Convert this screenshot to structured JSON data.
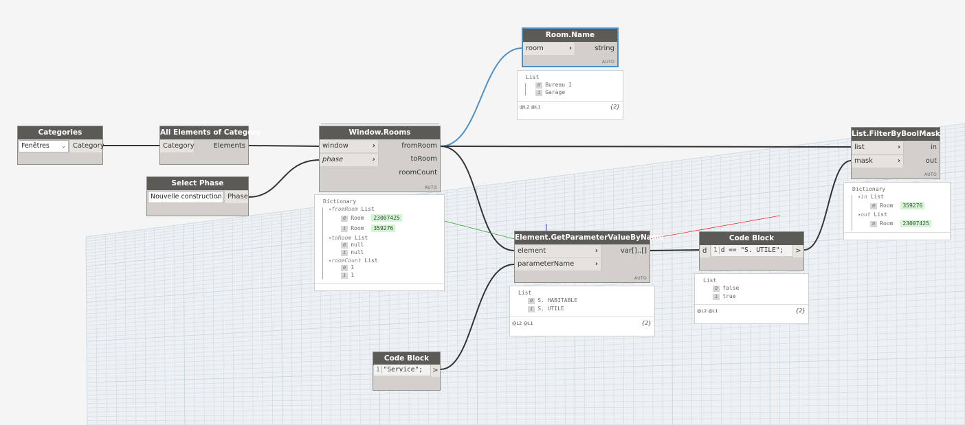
{
  "colors": {
    "canvas": "#f5f5f5",
    "grid": "#c9d6e0",
    "node_header": "#5c5a57",
    "node_body": "#d3d0cb",
    "wire": "#333333",
    "wire_selected": "#4a90c9",
    "value_highlight": "#d4f5d4"
  },
  "nodes": {
    "categories": {
      "title": "Categories",
      "selected": "Fenêtres",
      "output": "Category"
    },
    "all_elements": {
      "title": "All Elements of Category",
      "input": "Category",
      "output": "Elements"
    },
    "select_phase": {
      "title": "Select Phase",
      "selected": "Nouvelle construction",
      "output": "Phase"
    },
    "window_rooms": {
      "title": "Window.Rooms",
      "inputs": [
        "window",
        "phase"
      ],
      "outputs": [
        "fromRoom",
        "toRoom",
        "roomCount"
      ],
      "lacing": "AUTO",
      "preview": {
        "root": "Dictionary",
        "from_key": "fromRoom",
        "from_list": "List",
        "from_items": [
          {
            "i": "0",
            "t": "Room",
            "v": "23007425"
          },
          {
            "i": "1",
            "t": "Room",
            "v": "359276"
          }
        ],
        "to_key": "toRoom",
        "to_list": "List",
        "to_items": [
          {
            "i": "0",
            "v": "null"
          },
          {
            "i": "1",
            "v": "null"
          }
        ],
        "count_key": "roomCount",
        "count_list": "List",
        "count_items": [
          {
            "i": "0",
            "v": "1"
          },
          {
            "i": "1",
            "v": "1"
          }
        ]
      }
    },
    "room_name": {
      "title": "Room.Name",
      "input": "room",
      "output": "string",
      "lacing": "AUTO",
      "preview": {
        "root": "List",
        "items": [
          {
            "i": "0",
            "v": "Bureau 1"
          },
          {
            "i": "1",
            "v": "Garage"
          }
        ],
        "levels": "@L2 @L1",
        "count": "{2}"
      }
    },
    "get_param": {
      "title": "Element.GetParameterValueByName",
      "inputs": [
        "element",
        "parameterName"
      ],
      "output": "var[]..[]",
      "lacing": "AUTO",
      "preview": {
        "root": "List",
        "items": [
          {
            "i": "0",
            "v": "S. HABITABLE"
          },
          {
            "i": "1",
            "v": "S. UTILE"
          }
        ],
        "levels": "@L2 @L1",
        "count": "{2}"
      }
    },
    "code_block_1": {
      "title": "Code Block",
      "input": "d",
      "line": "1",
      "code": "d == \"S. UTILE\";",
      "output": ">",
      "preview": {
        "root": "List",
        "items": [
          {
            "i": "0",
            "v": "false"
          },
          {
            "i": "1",
            "v": "true"
          }
        ],
        "levels": "@L2 @L1",
        "count": "{2}"
      }
    },
    "code_block_2": {
      "title": "Code Block",
      "line": "1",
      "code": "\"Service\";",
      "output": ">"
    },
    "filter": {
      "title": "List.FilterByBoolMask",
      "inputs": [
        "list",
        "mask"
      ],
      "outputs": [
        "in",
        "out"
      ],
      "lacing": "AUTO",
      "preview": {
        "root": "Dictionary",
        "in_key": "in",
        "in_list": "List",
        "in_items": [
          {
            "i": "0",
            "t": "Room",
            "v": "359276"
          }
        ],
        "out_key": "out",
        "out_list": "List",
        "out_items": [
          {
            "i": "0",
            "t": "Room",
            "v": "23007425"
          }
        ]
      }
    }
  }
}
